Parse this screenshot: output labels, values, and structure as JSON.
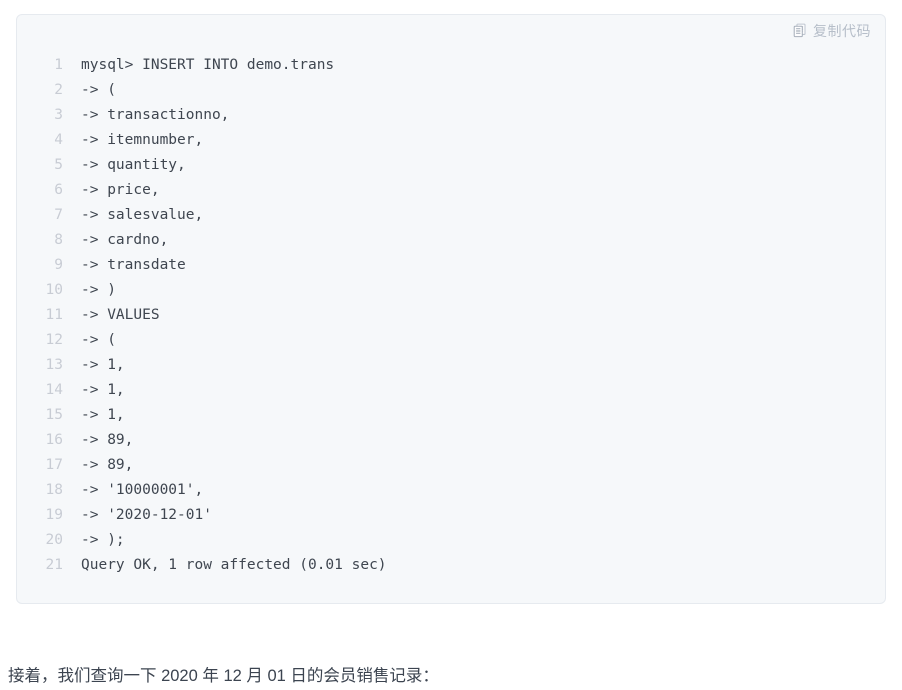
{
  "code_block": {
    "copy_button": {
      "label": "复制代码",
      "icon": "copy-icon"
    },
    "language": "mysql",
    "background_color": "#f6f8fa",
    "border_color": "#e6eaef",
    "text_color": "#3f4650",
    "line_number_color": "#c8ccd4",
    "lines": [
      {
        "n": "1",
        "text": "mysql> INSERT INTO demo.trans"
      },
      {
        "n": "2",
        "text": "-> ("
      },
      {
        "n": "3",
        "text": "-> transactionno,"
      },
      {
        "n": "4",
        "text": "-> itemnumber,"
      },
      {
        "n": "5",
        "text": "-> quantity,"
      },
      {
        "n": "6",
        "text": "-> price,"
      },
      {
        "n": "7",
        "text": "-> salesvalue,"
      },
      {
        "n": "8",
        "text": "-> cardno,"
      },
      {
        "n": "9",
        "text": "-> transdate"
      },
      {
        "n": "10",
        "text": "-> )"
      },
      {
        "n": "11",
        "text": "-> VALUES"
      },
      {
        "n": "12",
        "text": "-> ("
      },
      {
        "n": "13",
        "text": "-> 1,"
      },
      {
        "n": "14",
        "text": "-> 1,"
      },
      {
        "n": "15",
        "text": "-> 1,"
      },
      {
        "n": "16",
        "text": "-> 89,"
      },
      {
        "n": "17",
        "text": "-> 89,"
      },
      {
        "n": "18",
        "text": "-> '10000001',"
      },
      {
        "n": "19",
        "text": "-> '2020-12-01'"
      },
      {
        "n": "20",
        "text": "-> );"
      },
      {
        "n": "21",
        "text": "Query OK, 1 row affected (0.01 sec)"
      }
    ]
  },
  "paragraph": {
    "text": "接着，我们查询一下 2020 年 12 月 01 日的会员销售记录："
  }
}
